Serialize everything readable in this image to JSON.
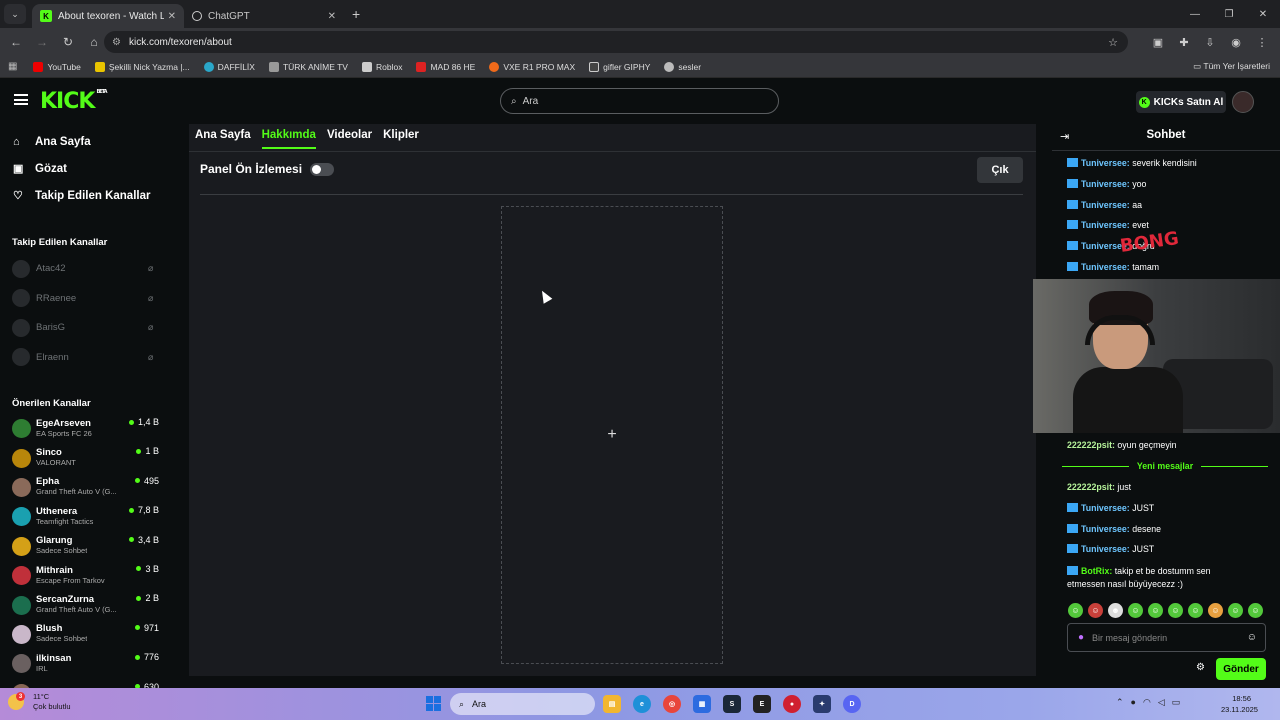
{
  "browser": {
    "tabs": [
      {
        "title": "About texoren - Watch Live on",
        "icon": "kick-favicon"
      },
      {
        "title": "ChatGPT",
        "icon": "chatgpt-favicon"
      }
    ],
    "url": "kick.com/texoren/about",
    "bookmarks": [
      "YouTube",
      "Şekilli Nick Yazma |...",
      "DAFFİLİX",
      "TÜRK ANİME TV",
      "Roblox",
      "MAD 86 HE",
      "VXE R1 PRO MAX",
      "gifler GIPHY",
      "sesler"
    ],
    "all_bookmarks": "Tüm Yer İşaretleri"
  },
  "header": {
    "logo": "KICK",
    "logo_tag": "BETA",
    "search_placeholder": "Ara",
    "buy_kicks": "KICKs Satın Al"
  },
  "sidebar": {
    "nav": [
      {
        "label": "Ana Sayfa",
        "icon": "home-icon"
      },
      {
        "label": "Gözat",
        "icon": "browse-icon"
      },
      {
        "label": "Takip Edilen Kanallar",
        "icon": "heart-icon"
      }
    ],
    "followed_title": "Takip Edilen Kanallar",
    "followed": [
      "Atac42",
      "RRaenee",
      "BarisG",
      "Elraenn"
    ],
    "recommended_title": "Önerilen Kanallar",
    "recommended": [
      {
        "name": "EgeArseven",
        "game": "EA Sports FC 26",
        "viewers": "1,4 B",
        "color": "#2e7d32"
      },
      {
        "name": "Sinco",
        "game": "VALORANT",
        "viewers": "1 B",
        "color": "#b8860b"
      },
      {
        "name": "Epha",
        "game": "Grand Theft Auto V (G...",
        "viewers": "495",
        "color": "#8a6a5a"
      },
      {
        "name": "Uthenera",
        "game": "Teamfight Tactics",
        "viewers": "7,8 B",
        "color": "#1aa0b0"
      },
      {
        "name": "Glarung",
        "game": "Sadece Sohbet",
        "viewers": "3,4 B",
        "color": "#d4a017"
      },
      {
        "name": "Mithrain",
        "game": "Escape From Tarkov",
        "viewers": "3 B",
        "color": "#c0303a"
      },
      {
        "name": "SercanZurna",
        "game": "Grand Theft Auto V (G...",
        "viewers": "2 B",
        "color": "#1b6e4e"
      },
      {
        "name": "Blush",
        "game": "Sadece Sohbet",
        "viewers": "971",
        "color": "#c9b7c9"
      },
      {
        "name": "ilkinsan",
        "game": "IRL",
        "viewers": "776",
        "color": "#6a6060"
      },
      {
        "name": "Gogo",
        "game": "",
        "viewers": "630",
        "color": "#886655"
      }
    ]
  },
  "main": {
    "tabs": [
      "Ana Sayfa",
      "Hakkımda",
      "Videolar",
      "Klipler"
    ],
    "active_tab": 1,
    "panel_preview": "Panel Ön İzlemesi",
    "exit": "Çık",
    "add": "+"
  },
  "chat": {
    "title": "Sohbet",
    "messages_top": [
      {
        "user": "Tuniversee:",
        "text": "severik kendisini"
      },
      {
        "user": "Tuniversee:",
        "text": "yoo"
      },
      {
        "user": "Tuniversee:",
        "text": "aa"
      },
      {
        "user": "Tuniversee:",
        "text": "evet"
      },
      {
        "user": "Tuniversee:",
        "text": "doğru"
      },
      {
        "user": "Tuniversee:",
        "text": "tamam"
      }
    ],
    "overlay_text": "BONG",
    "msg_222_1": {
      "user": "222222psit:",
      "text": "oyun geçmeyin"
    },
    "new_messages": "Yeni mesajlar",
    "messages_bottom": [
      {
        "user": "222222psit:",
        "text": "just"
      },
      {
        "user": "Tuniversee:",
        "text": "JUST"
      },
      {
        "user": "Tuniversee:",
        "text": "desene"
      },
      {
        "user": "Tuniversee:",
        "text": "JUST"
      }
    ],
    "bot": {
      "user": "BotRix:",
      "text": "takip et be dostumm sen",
      "text2": "etmessen nasıl büyüyecezz :)"
    },
    "input_placeholder": "Bir mesaj gönderin",
    "send": "Gönder"
  },
  "taskbar": {
    "temp": "11°C",
    "weather": "Çok bulutlu",
    "search": "Ara",
    "time": "18:56",
    "date": "23.11.2025"
  }
}
